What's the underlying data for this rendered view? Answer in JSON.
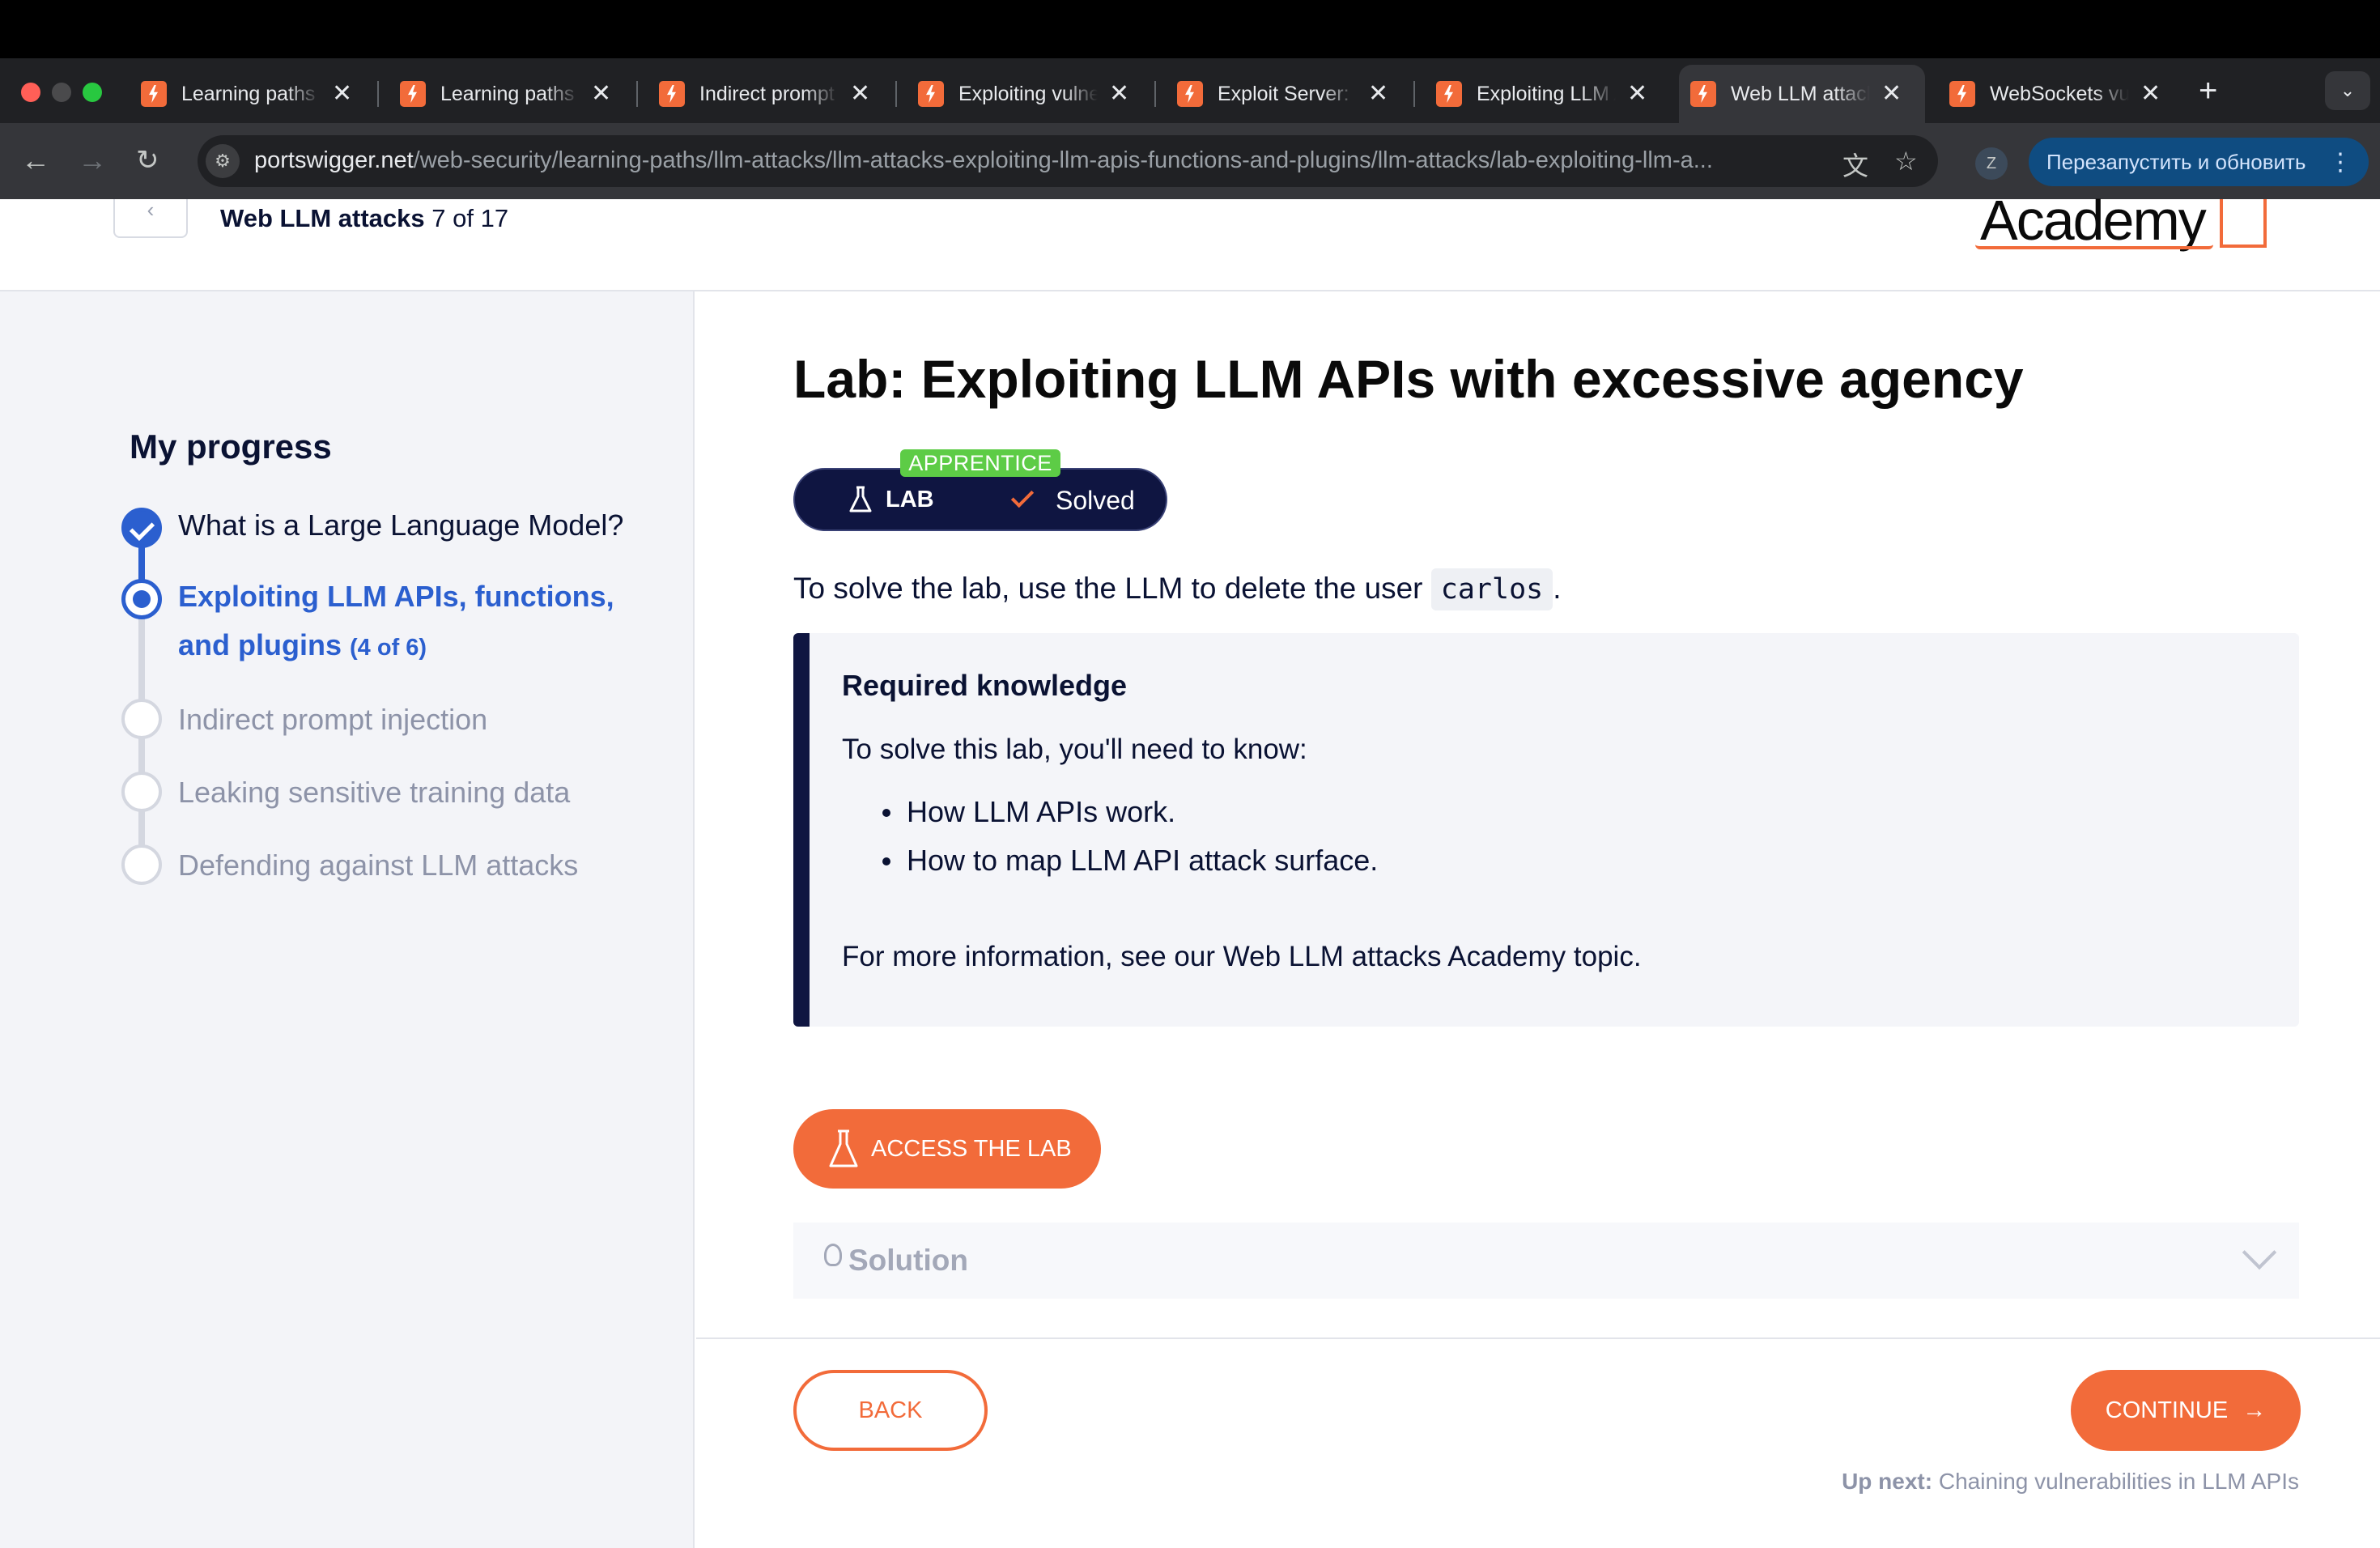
{
  "browser": {
    "tabs": [
      {
        "title": "Learning paths | Web Security Academy",
        "active": false
      },
      {
        "title": "Learning paths | Web Security Academy",
        "active": false
      },
      {
        "title": "Indirect prompt injection",
        "active": false
      },
      {
        "title": "Exploiting vulnerabilities in LLM APIs",
        "active": false
      },
      {
        "title": "Exploit Server: Indirect prompt injection",
        "active": false
      },
      {
        "title": "Exploiting LLM APIs with excessive agency",
        "active": false
      },
      {
        "title": "Web LLM attacks",
        "active": true
      },
      {
        "title": "WebSockets vulnerabilities",
        "active": false
      }
    ],
    "new_tab": "+",
    "tab_close": "✕",
    "tab_menu": "⌄",
    "url_host": "portswigger.net",
    "url_path": "/web-security/learning-paths/llm-attacks/llm-attacks-exploiting-llm-apis-functions-and-plugins/llm-attacks/lab-exploiting-llm-a...",
    "profile_initial": "Z",
    "relaunch_label": "Перезапустить и обновить",
    "icons": {
      "back": "arrow-left-icon",
      "forward": "arrow-right-icon",
      "reload": "reload-icon",
      "site_info": "tune-icon",
      "translate": "translate-icon",
      "bookmark": "star-icon",
      "menu": "kebab-icon"
    }
  },
  "header": {
    "course_name": "Web LLM attacks",
    "course_position": "7 of 17",
    "logo_text": "Academy"
  },
  "sidebar": {
    "title": "My progress",
    "steps": [
      {
        "label": "What is a Large Language Model?",
        "state": "done"
      },
      {
        "label": "Exploiting LLM APIs, functions,",
        "label2": "and plugins",
        "count": "(4 of 6)",
        "state": "current"
      },
      {
        "label": "Indirect prompt injection",
        "state": "todo"
      },
      {
        "label": "Leaking sensitive training data",
        "state": "todo"
      },
      {
        "label": "Defending against LLM attacks",
        "state": "todo"
      }
    ]
  },
  "main": {
    "title": "Lab: Exploiting LLM APIs with excessive agency",
    "level": "APPRENTICE",
    "lab_label": "LAB",
    "status": "Solved",
    "intro_before": "To solve the lab, use the LLM to delete the user ",
    "intro_code": "carlos",
    "intro_after": ".",
    "knowledge": {
      "title": "Required knowledge",
      "text": "To solve this lab, you'll need to know:",
      "items": [
        "How LLM APIs work.",
        "How to map LLM API attack surface."
      ],
      "more": "For more information, see our Web LLM attacks Academy topic."
    },
    "access_label": "ACCESS THE LAB",
    "solution_label": "Solution"
  },
  "footer": {
    "back_label": "BACK",
    "continue_label": "CONTINUE",
    "continue_arrow": "→",
    "upnext_label": "Up next:",
    "upnext_title": "Chaining vulnerabilities in LLM APIs"
  },
  "colors": {
    "accent": "#f26b3a",
    "navy": "#0f1541",
    "progress_blue": "#2b5fcf",
    "apprentice_green": "#5dcc46"
  }
}
